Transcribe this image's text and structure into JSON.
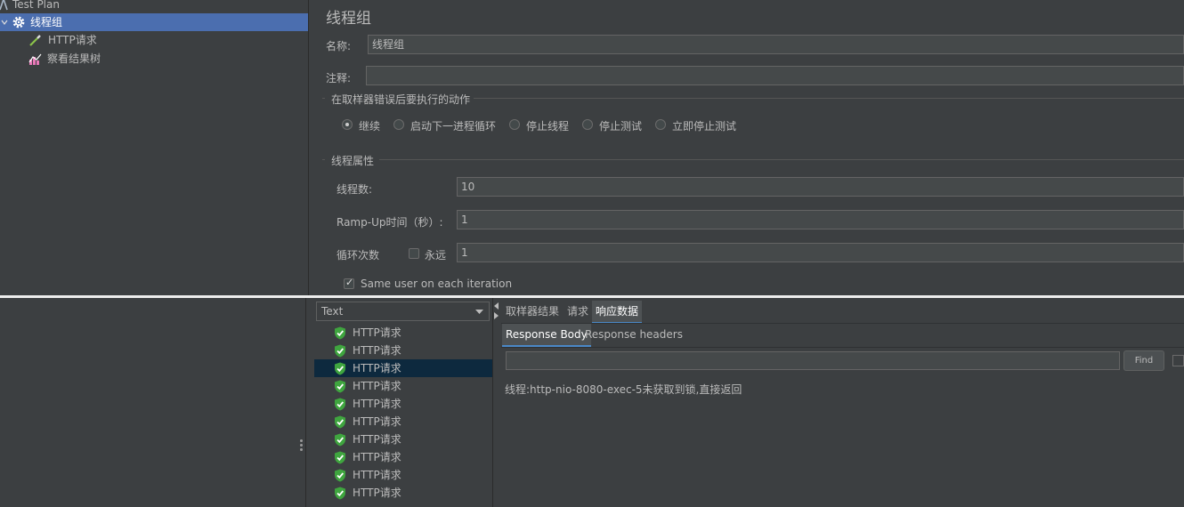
{
  "tree": {
    "root_label": "Test Plan",
    "thread_group_label": "线程组",
    "http_request_label": "HTTP请求",
    "view_results_tree_label": "察看结果树"
  },
  "thread_group": {
    "title": "线程组",
    "name_label": "名称:",
    "name_value": "线程组",
    "comment_label": "注释:",
    "comment_value": "",
    "on_error": {
      "title": "在取样器错误后要执行的动作",
      "options": [
        "继续",
        "启动下一进程循环",
        "停止线程",
        "停止测试",
        "立即停止测试"
      ],
      "selected": "继续"
    },
    "properties": {
      "title": "线程属性",
      "threads_label": "线程数:",
      "threads_value": "10",
      "rampup_label": "Ramp-Up时间（秒）:",
      "rampup_value": "1",
      "loop_label": "循环次数",
      "forever_label": "永远",
      "forever_checked": false,
      "loop_value": "1",
      "same_user_label": "Same user on each iteration",
      "same_user_checked": true
    }
  },
  "results": {
    "render_select_value": "Text",
    "items": [
      "HTTP请求",
      "HTTP请求",
      "HTTP请求",
      "HTTP请求",
      "HTTP请求",
      "HTTP请求",
      "HTTP请求",
      "HTTP请求",
      "HTTP请求",
      "HTTP请求"
    ],
    "selected_index": 2,
    "status_color": "#3fa53f"
  },
  "detail": {
    "tabs": [
      "取样器结果",
      "请求",
      "响应数据"
    ],
    "active_tab": "响应数据",
    "subtabs": [
      "Response Body",
      "Response headers"
    ],
    "active_subtab": "Response Body",
    "find_button_label": "Find",
    "find_value": "",
    "response_body": "线程:http-nio-8080-exec-5未获取到锁,直接返回"
  }
}
